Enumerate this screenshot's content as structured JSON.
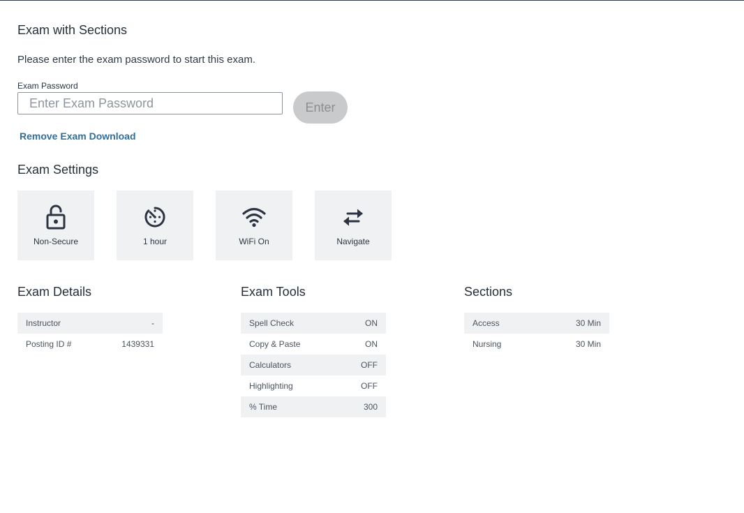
{
  "exam": {
    "title": "Exam with Sections",
    "instructions": "Please enter the exam password to start this exam.",
    "password_label": "Exam Password",
    "password_placeholder": "Enter Exam Password",
    "password_value": "",
    "enter_label": "Enter",
    "remove_download_label": "Remove Exam Download"
  },
  "settings": {
    "heading": "Exam Settings",
    "tiles": [
      {
        "icon": "unlocked-padlock-icon",
        "label": "Non-Secure"
      },
      {
        "icon": "timer-clock-icon",
        "label": "1 hour"
      },
      {
        "icon": "wifi-icon",
        "label": "WiFi On"
      },
      {
        "icon": "swap-arrows-icon",
        "label": "Navigate"
      }
    ]
  },
  "details": {
    "heading": "Exam Details",
    "rows": [
      {
        "label": "Instructor",
        "value": "-"
      },
      {
        "label": "Posting ID #",
        "value": "1439331"
      }
    ]
  },
  "tools": {
    "heading": "Exam Tools",
    "rows": [
      {
        "label": "Spell Check",
        "value": "ON"
      },
      {
        "label": "Copy & Paste",
        "value": "ON"
      },
      {
        "label": "Calculators",
        "value": "OFF"
      },
      {
        "label": "Highlighting",
        "value": "OFF"
      },
      {
        "label": "% Time",
        "value": "300"
      }
    ]
  },
  "sections": {
    "heading": "Sections",
    "rows": [
      {
        "label": "Access",
        "value": "30 Min"
      },
      {
        "label": "Nursing",
        "value": "30 Min"
      }
    ]
  },
  "colors": {
    "text": "#25303b",
    "link": "#2f6f9f",
    "tile_bg": "#f0f1f3",
    "button_disabled_bg": "#c9cacb"
  }
}
